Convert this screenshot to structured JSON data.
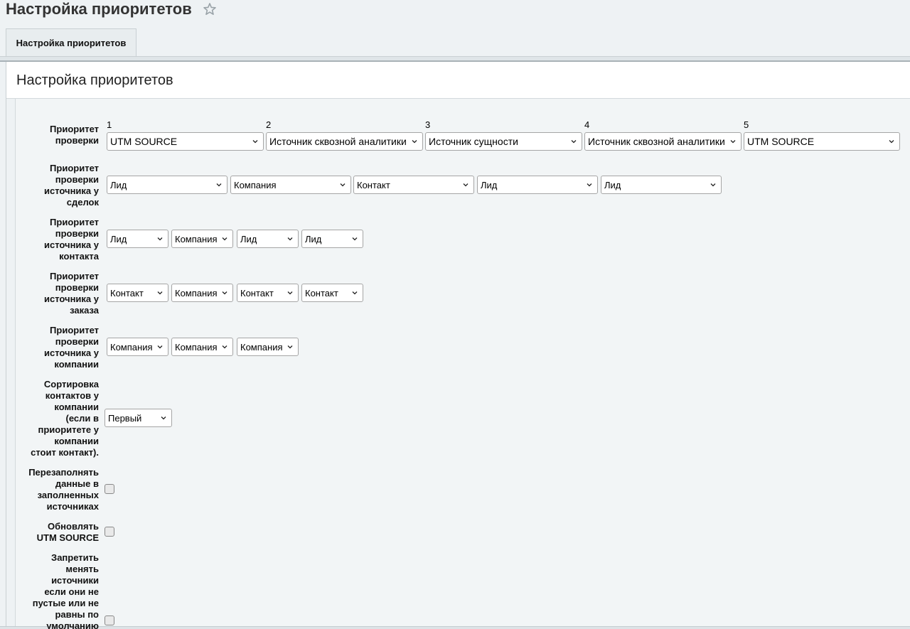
{
  "page": {
    "title": "Настройка приоритетов"
  },
  "tab": {
    "label": "Настройка приоритетов"
  },
  "section": {
    "title": "Настройка приоритетов"
  },
  "columns": [
    "1",
    "2",
    "3",
    "4",
    "5"
  ],
  "rows": {
    "check_priority": {
      "label": "Приоритет проверки",
      "values": [
        "UTM SOURCE",
        "Источник сквозной аналитики",
        "Источник сущности",
        "Источник сквозной аналитики",
        "UTM SOURCE"
      ]
    },
    "deals": {
      "label": "Приоритет проверки источника у сделок",
      "values": [
        "Лид",
        "Компания",
        "Контакт",
        "Лид",
        "Лид"
      ]
    },
    "contact": {
      "label": "Приоритет проверки источника у контакта",
      "values": [
        "Лид",
        "Компания",
        "Лид",
        "Лид"
      ]
    },
    "order": {
      "label": "Приоритет проверки источника у заказа",
      "values": [
        "Контакт",
        "Компания",
        "Контакт",
        "Контакт"
      ]
    },
    "company": {
      "label": "Приоритет проверки источника у компании",
      "values": [
        "Компания",
        "Компания",
        "Компания"
      ]
    },
    "sort_contacts": {
      "label": "Сортировка контактов у компании (если в приоритете у компании стоит контакт).",
      "value": "Первый"
    },
    "refill": {
      "label": "Перезаполнять данные в заполненных источниках",
      "checked": false
    },
    "update_utm": {
      "label": "Обновлять UTM SOURCE",
      "checked": false
    },
    "forbid_change": {
      "label": "Запретить менять источники если они не пустые или не равны по умолчанию",
      "checked": false
    }
  }
}
